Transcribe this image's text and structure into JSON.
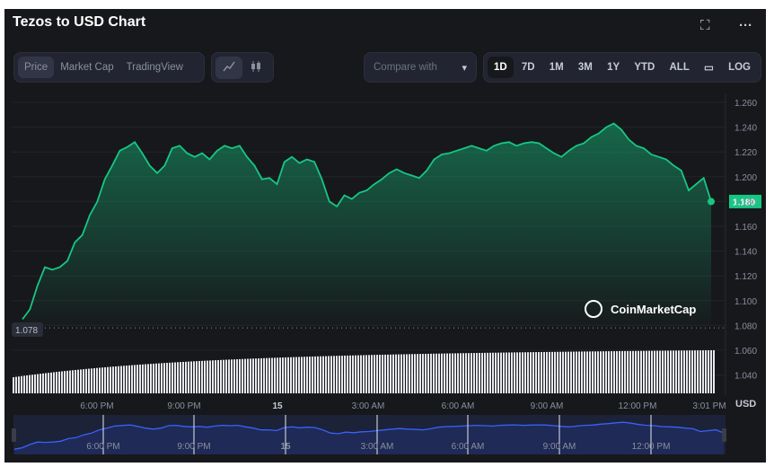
{
  "header": {
    "title": "Tezos to USD Chart",
    "fullscreen_icon": "fullscreen-icon",
    "more_icon": "more-dots-icon"
  },
  "toolbar": {
    "view_tabs": [
      {
        "label": "Price",
        "active": true
      },
      {
        "label": "Market Cap"
      },
      {
        "label": "TradingView"
      }
    ],
    "chart_type_icons": [
      "line-chart-icon",
      "candlestick-icon"
    ],
    "compare_placeholder": "Compare with",
    "ranges": [
      {
        "label": "1D",
        "active": true
      },
      {
        "label": "7D"
      },
      {
        "label": "1M"
      },
      {
        "label": "3M"
      },
      {
        "label": "1Y"
      },
      {
        "label": "YTD"
      },
      {
        "label": "ALL"
      }
    ],
    "calendar_icon": "calendar-icon",
    "log_label": "LOG"
  },
  "watermark": "CoinMarketCap",
  "colors": {
    "line": "#16c784",
    "navigator": "#3861fb",
    "background": "#17181b"
  },
  "chart_data": {
    "type": "area",
    "xlabel": "",
    "ylabel": "",
    "y_unit": "USD",
    "ylim": [
      1.03,
      1.27
    ],
    "y_ticks": [
      "1.260",
      "1.240",
      "1.220",
      "1.200",
      "1.180",
      "1.160",
      "1.140",
      "1.120",
      "1.100",
      "1.080",
      "1.060",
      "1.040"
    ],
    "x_ticks": [
      "6:00 PM",
      "9:00 PM",
      "15",
      "3:00 AM",
      "6:00 AM",
      "9:00 AM",
      "12:00 PM",
      "3:01 PM"
    ],
    "current_price_label": "1.180",
    "open_price_label": "1.078",
    "open_price": 1.078,
    "values": [
      1.085,
      1.093,
      1.112,
      1.127,
      1.125,
      1.127,
      1.132,
      1.147,
      1.153,
      1.169,
      1.18,
      1.198,
      1.209,
      1.221,
      1.224,
      1.228,
      1.219,
      1.209,
      1.203,
      1.209,
      1.223,
      1.225,
      1.219,
      1.216,
      1.219,
      1.214,
      1.221,
      1.225,
      1.223,
      1.225,
      1.216,
      1.209,
      1.198,
      1.199,
      1.194,
      1.212,
      1.216,
      1.211,
      1.214,
      1.212,
      1.198,
      1.18,
      1.176,
      1.185,
      1.182,
      1.187,
      1.189,
      1.194,
      1.198,
      1.203,
      1.206,
      1.203,
      1.201,
      1.199,
      1.205,
      1.214,
      1.218,
      1.219,
      1.221,
      1.223,
      1.225,
      1.223,
      1.221,
      1.225,
      1.227,
      1.228,
      1.225,
      1.227,
      1.228,
      1.227,
      1.223,
      1.219,
      1.216,
      1.221,
      1.225,
      1.227,
      1.232,
      1.235,
      1.24,
      1.243,
      1.238,
      1.23,
      1.225,
      1.223,
      1.218,
      1.216,
      1.214,
      1.209,
      1.205,
      1.189,
      1.194,
      1.199,
      1.18
    ],
    "navigator_x_ticks": [
      "6:00 PM",
      "9:00 PM",
      "15",
      "3:00 AM",
      "6:00 AM",
      "9:00 AM",
      "12:00 PM"
    ]
  }
}
